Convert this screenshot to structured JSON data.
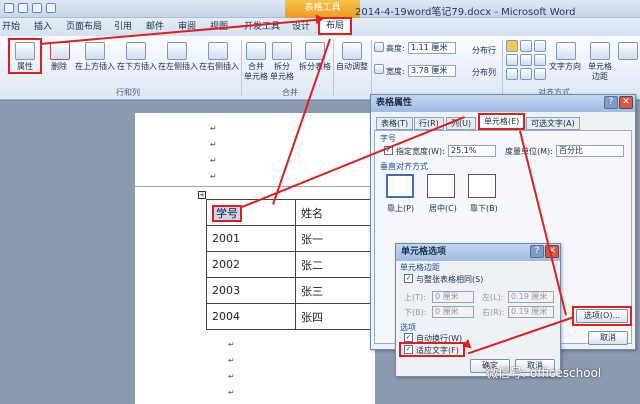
{
  "title_bar": {
    "title": "2014-4-19word笔记79.docx - Microsoft Word",
    "context_tab": "表格工具"
  },
  "tabs": [
    "开始",
    "插入",
    "页面布局",
    "引用",
    "邮件",
    "审阅",
    "视图",
    "开发工具",
    "设计",
    "布局"
  ],
  "ribbon": {
    "properties": "属性",
    "delete": "删除",
    "insert_above": "在上方插入",
    "insert_below": "在下方插入",
    "insert_left": "在左侧插入",
    "insert_right": "在右侧插入",
    "merge_cells": "合并\n单元格",
    "split_cells": "拆分\n单元格",
    "split_table": "拆分表格",
    "autofit": "自动调整",
    "height_label": "高度:",
    "height_value": "1.11 厘米",
    "width_label": "宽度:",
    "width_value": "3.78 厘米",
    "distribute_rows": "分布行",
    "distribute_cols": "分布列",
    "text_direction": "文字方向",
    "cell_margins": "单元格\n边距",
    "group_rows_cols": "行和列",
    "group_merge": "合并",
    "group_align": "对齐方式"
  },
  "document": {
    "table": [
      [
        "学号",
        "姓名"
      ],
      [
        "2001",
        "张一"
      ],
      [
        "2002",
        "张二"
      ],
      [
        "2003",
        "张三"
      ],
      [
        "2004",
        "张四"
      ]
    ],
    "para_mark": "↵"
  },
  "table_properties": {
    "title": "表格属性",
    "tabs": [
      "表格(T)",
      "行(R)",
      "列(U)",
      "单元格(E)",
      "可选文字(A)"
    ],
    "size_header": "字号",
    "specify_width": "指定宽度(W):",
    "width_value": "25.1%",
    "measure_in": "度量单位(M):",
    "measure_value": "百分比",
    "valign_header": "垂直对齐方式",
    "valign_options": [
      "靠上(P)",
      "居中(C)",
      "靠下(B)"
    ],
    "options_button": "选项(O)...",
    "cancel_button": "取消"
  },
  "cell_options": {
    "title": "单元格选项",
    "margins_header": "单元格边距",
    "same_as_table": "与整张表格相同(S)",
    "top_label": "上(T):",
    "top_value": "0 厘米",
    "bottom_label": "下(B):",
    "bottom_value": "0 厘米",
    "left_label": "左(L):",
    "left_value": "0.19 厘米",
    "right_label": "右(R):",
    "right_value": "0.19 厘米",
    "options_header": "选项",
    "wrap_text": "自动换行(W)",
    "fit_text": "适应文字(F)",
    "ok_button": "确定",
    "cancel_button": "取消"
  },
  "watermark": "微信号: officeschool",
  "colors": {
    "annotation_red": "#e11d1d",
    "context_orange": "#eaa12a"
  }
}
